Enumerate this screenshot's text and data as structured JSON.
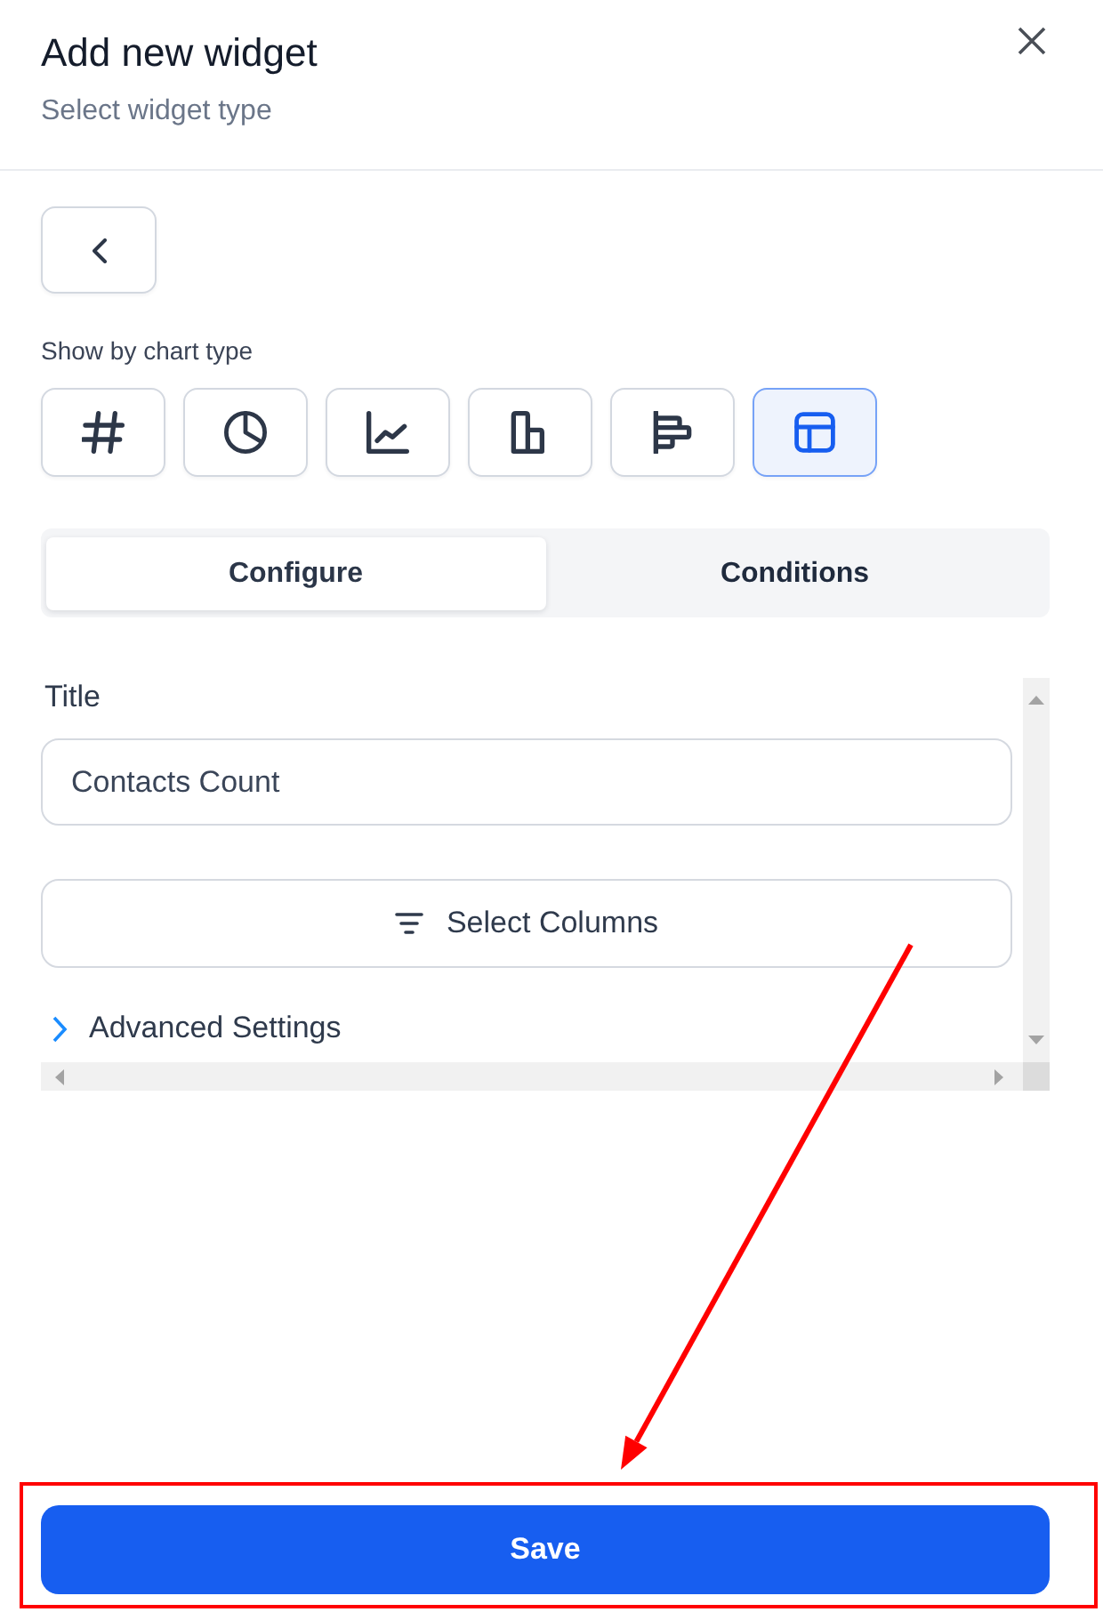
{
  "header": {
    "title": "Add new widget",
    "subtitle": "Select widget type"
  },
  "chart_type_label": "Show by chart type",
  "chart_types": [
    {
      "kind": "number",
      "selected": false
    },
    {
      "kind": "pie",
      "selected": false
    },
    {
      "kind": "line",
      "selected": false
    },
    {
      "kind": "bar",
      "selected": false
    },
    {
      "kind": "horizontal-bar",
      "selected": false
    },
    {
      "kind": "table",
      "selected": true
    }
  ],
  "tabs": [
    {
      "label": "Configure",
      "selected": true
    },
    {
      "label": "Conditions",
      "selected": false
    }
  ],
  "form": {
    "title_label": "Title",
    "title_value": "Contacts Count",
    "select_columns": "Select Columns",
    "advanced": {
      "label": "Advanced Settings",
      "expanded": false
    }
  },
  "save_button": "Save",
  "annotation": {
    "kind": "arrow-to-box"
  }
}
